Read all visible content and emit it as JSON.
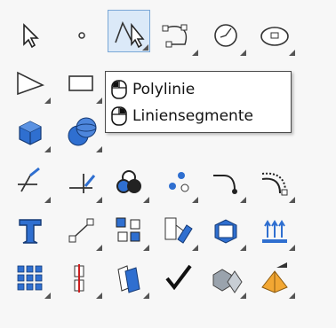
{
  "tooltip": {
    "items": [
      {
        "label": "Polylinie",
        "mouse_button": "left"
      },
      {
        "label": "Liniensegmente",
        "mouse_button": "right"
      }
    ]
  },
  "toolbar": {
    "rows": [
      [
        "select-arrow-icon",
        "point-icon",
        "polyline-icon",
        "curve-control-points-icon",
        "circle-icon",
        "ellipse-icon"
      ],
      [
        "polygon-icon",
        "rectangle-icon",
        "hidden-tool-icon",
        "hidden-tool-icon",
        "hidden-tool-icon",
        "hidden-tool-icon"
      ],
      [
        "box-icon",
        "boolean-spheres-icon",
        "hidden-tool-icon",
        "hidden-tool-icon",
        "hidden-tool-icon",
        "hidden-tool-icon"
      ],
      [
        "extend-line-icon",
        "trim-line-icon",
        "color-circles-icon",
        "point-cloud-icon",
        "fillet-curve-icon",
        "offset-curve-icon"
      ],
      [
        "text-icon",
        "scale-icon",
        "group-icon",
        "move-object-icon",
        "block-cube-icon",
        "dimension-icon"
      ],
      [
        "grid-array-icon",
        "mirror-icon",
        "duplicate-icon",
        "check-icon",
        "shade-object-icon",
        "render-pyramid-icon"
      ]
    ]
  },
  "colors": {
    "accent_blue": "#2f6fd0",
    "active_bg": "#dbe9f8",
    "tooltip_border": "#4b4b4b"
  }
}
